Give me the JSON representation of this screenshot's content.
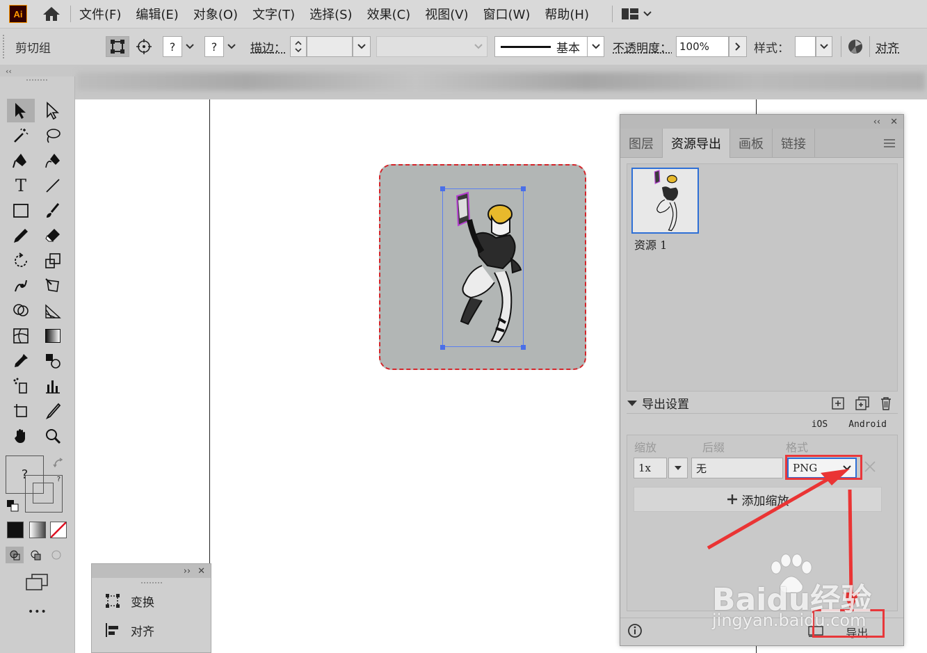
{
  "menubar": {
    "logo": "Ai",
    "items": [
      "文件(F)",
      "编辑(E)",
      "对象(O)",
      "文字(T)",
      "选择(S)",
      "效果(C)",
      "视图(V)",
      "窗口(W)",
      "帮助(H)"
    ]
  },
  "controlbar": {
    "selection_label": "剪切组",
    "fill_q": "?",
    "stroke_q": "?",
    "stroke_label": "描边：",
    "stroke_style": "基本",
    "opacity_label": "不透明度：",
    "opacity_value": "100%",
    "style_label": "样式：",
    "align_label": "对齐"
  },
  "toolbar": {
    "fill_q": "?",
    "stroke_q": "?",
    "more": "•••"
  },
  "minipanel": {
    "items": [
      "变换",
      "对齐"
    ]
  },
  "asset_panel": {
    "tabs": [
      "图层",
      "资源导出",
      "画板",
      "链接"
    ],
    "asset_name": "资源 1",
    "settings_title": "导出设置",
    "platforms": [
      "iOS",
      "Android"
    ],
    "columns": [
      "缩放",
      "后缀",
      "格式"
    ],
    "scale_value": "1x",
    "suffix_value": "无",
    "format_value": "PNG",
    "add_scale_label": "添加缩放",
    "export_label": "导出..."
  },
  "watermark": {
    "brand": "Baidu经验",
    "url": "jingyan.baidu.com"
  },
  "colors": {
    "accent_blue": "#2e6fd6",
    "annotation_red": "#e8373a",
    "clip_border": "#d4252a"
  }
}
